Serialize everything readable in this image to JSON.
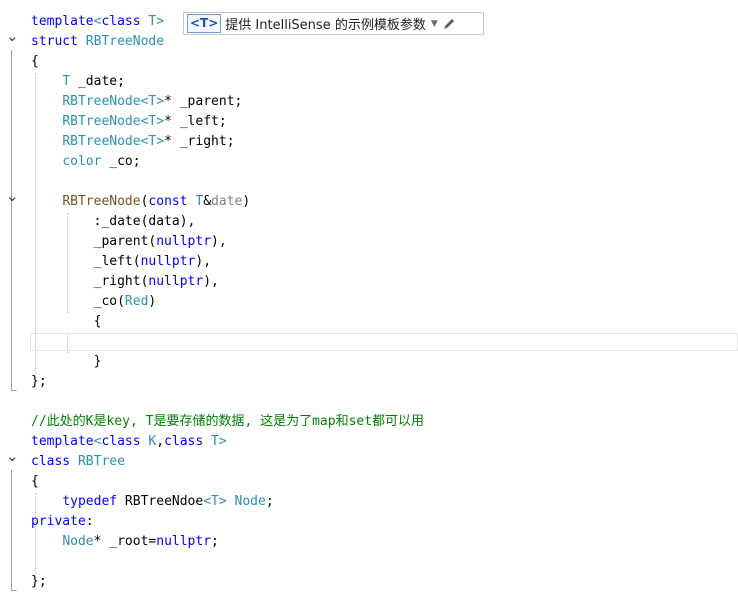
{
  "template_bar": {
    "badge": "<T>",
    "text": "提供 IntelliSense 的示例模板参数",
    "dropdown_icon": "chevron-down-icon",
    "edit_icon": "pencil-icon"
  },
  "editor": {
    "language": "C++",
    "lines": [
      [
        [
          "template",
          "kw"
        ],
        [
          "<",
          "ty"
        ],
        [
          "class",
          "kw"
        ],
        [
          " ",
          "ctxt"
        ],
        [
          "T",
          "ty"
        ],
        [
          ">",
          "ty"
        ]
      ],
      [
        [
          "struct",
          "kw"
        ],
        [
          " ",
          "ctxt"
        ],
        [
          "RBTreeNode",
          "ty"
        ]
      ],
      [
        [
          "{",
          "ctxt"
        ]
      ],
      [
        [
          "    ",
          "ctxt"
        ],
        [
          "T",
          "ty"
        ],
        [
          " _date;",
          "ctxt"
        ]
      ],
      [
        [
          "    ",
          "ctxt"
        ],
        [
          "RBTreeNode",
          "ty"
        ],
        [
          "<",
          "ty"
        ],
        [
          "T",
          "ty"
        ],
        [
          ">",
          "ty"
        ],
        [
          "* _parent;",
          "ctxt"
        ]
      ],
      [
        [
          "    ",
          "ctxt"
        ],
        [
          "RBTreeNode",
          "ty"
        ],
        [
          "<",
          "ty"
        ],
        [
          "T",
          "ty"
        ],
        [
          ">",
          "ty"
        ],
        [
          "* _left;",
          "ctxt"
        ]
      ],
      [
        [
          "    ",
          "ctxt"
        ],
        [
          "RBTreeNode",
          "ty"
        ],
        [
          "<",
          "ty"
        ],
        [
          "T",
          "ty"
        ],
        [
          ">",
          "ty"
        ],
        [
          "* _right;",
          "ctxt"
        ]
      ],
      [
        [
          "    ",
          "ctxt"
        ],
        [
          "color",
          "ty"
        ],
        [
          " _co;",
          "ctxt"
        ]
      ],
      [],
      [
        [
          "    ",
          "ctxt"
        ],
        [
          "RBTreeNode",
          "fn"
        ],
        [
          "(",
          "ctxt"
        ],
        [
          "const",
          "kw"
        ],
        [
          " ",
          "ctxt"
        ],
        [
          "T",
          "ty"
        ],
        [
          "&",
          "ctxt"
        ],
        [
          "date",
          "pm"
        ],
        [
          ")",
          "ctxt"
        ]
      ],
      [
        [
          "        :_date(data),",
          "ctxt"
        ]
      ],
      [
        [
          "        _parent(",
          "ctxt"
        ],
        [
          "nullptr",
          "kw"
        ],
        [
          "),",
          "ctxt"
        ]
      ],
      [
        [
          "        _left(",
          "ctxt"
        ],
        [
          "nullptr",
          "kw"
        ],
        [
          "),",
          "ctxt"
        ]
      ],
      [
        [
          "        _right(",
          "ctxt"
        ],
        [
          "nullptr",
          "kw"
        ],
        [
          "),",
          "ctxt"
        ]
      ],
      [
        [
          "        _co(",
          "ctxt"
        ],
        [
          "Red",
          "ty"
        ],
        [
          ")",
          "ctxt"
        ]
      ],
      [
        [
          "        {",
          "ctxt"
        ]
      ],
      [],
      [
        [
          "        }",
          "ctxt"
        ]
      ],
      [
        [
          "};",
          "ctxt"
        ]
      ],
      [],
      [
        [
          "//此处的K是key, T是要存储的数据, 这是为了map和set都可以用",
          "cm"
        ]
      ],
      [
        [
          "template",
          "kw"
        ],
        [
          "<",
          "ty"
        ],
        [
          "class",
          "kw"
        ],
        [
          " ",
          "ctxt"
        ],
        [
          "K",
          "ty"
        ],
        [
          ",",
          "ctxt"
        ],
        [
          "class",
          "kw"
        ],
        [
          " ",
          "ctxt"
        ],
        [
          "T",
          "ty"
        ],
        [
          ">",
          "ty"
        ]
      ],
      [
        [
          "class",
          "kw"
        ],
        [
          " ",
          "ctxt"
        ],
        [
          "RBTree",
          "ty"
        ]
      ],
      [
        [
          "{",
          "ctxt"
        ]
      ],
      [
        [
          "    ",
          "ctxt"
        ],
        [
          "typedef",
          "kw"
        ],
        [
          " RBTreeNdoe",
          "ctxt"
        ],
        [
          "<",
          "ty"
        ],
        [
          "T",
          "ty"
        ],
        [
          ">",
          "ty"
        ],
        [
          " ",
          "ctxt"
        ],
        [
          "Node",
          "ty"
        ],
        [
          ";",
          "ctxt"
        ]
      ],
      [
        [
          "private",
          "kw"
        ],
        [
          ":",
          "ctxt"
        ]
      ],
      [
        [
          "    ",
          "ctxt"
        ],
        [
          "Node",
          "ty"
        ],
        [
          "* _root=",
          "ctxt"
        ],
        [
          "nullptr",
          "kw"
        ],
        [
          ";",
          "ctxt"
        ]
      ],
      [],
      [
        [
          "};",
          "ctxt"
        ]
      ]
    ],
    "fold_markers": [
      {
        "line": 1,
        "icon": "chevron-down-icon"
      },
      {
        "line": 9,
        "icon": "chevron-down-icon"
      },
      {
        "line": 22,
        "icon": "chevron-down-icon"
      }
    ]
  }
}
